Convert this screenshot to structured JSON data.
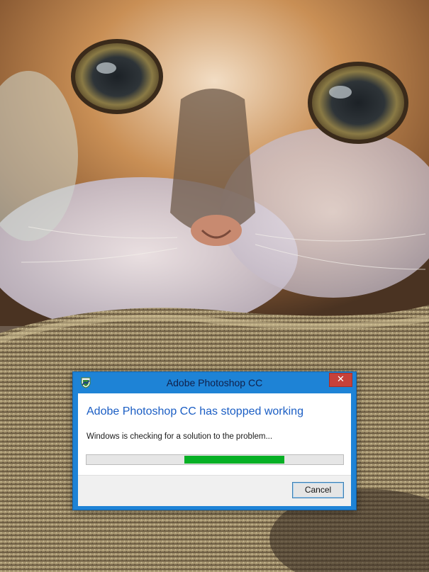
{
  "background": {
    "subject": "cat-photo"
  },
  "dialog": {
    "title": "Adobe Photoshop CC",
    "icon": "app-shield-icon",
    "close_glyph": "✕",
    "heading": "Adobe Photoshop CC has stopped working",
    "message": "Windows is checking for a solution to the problem...",
    "progress": {
      "start_fraction": 0.38,
      "end_fraction": 0.77,
      "color": "#06b025"
    },
    "cancel_label": "Cancel"
  },
  "colors": {
    "titlebar": "#1e83d6",
    "heading": "#1b5ec4",
    "close_button": "#c7413a"
  }
}
